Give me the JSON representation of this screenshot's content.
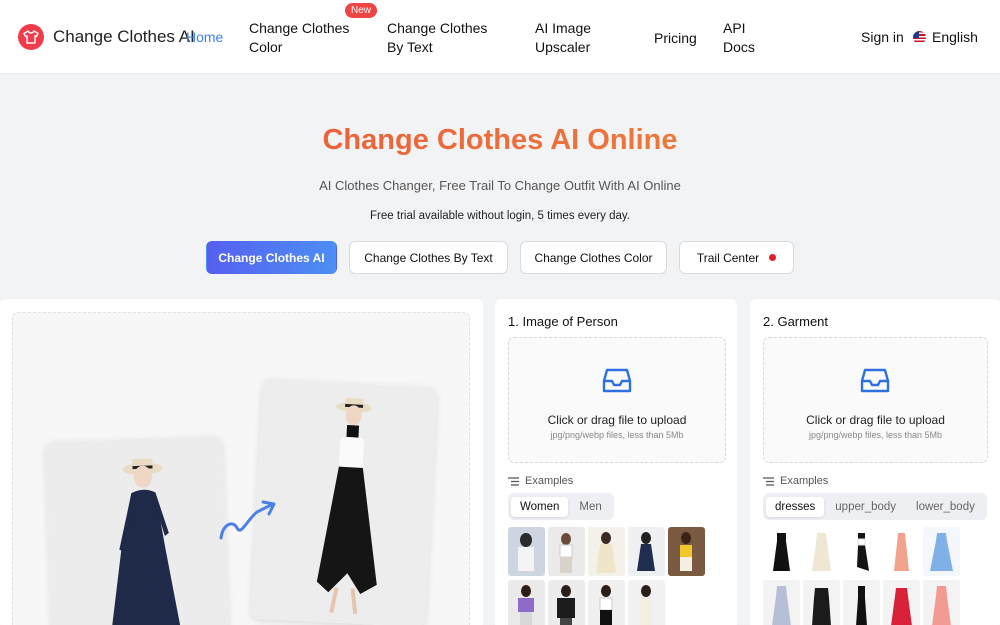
{
  "header": {
    "brand": "Change Clothes AI",
    "nav": [
      "Home",
      "Change Clothes Color",
      "Change Clothes By Text",
      "AI Image Upscaler",
      "Pricing",
      "API Docs"
    ],
    "badge_new": "New",
    "signin": "Sign in",
    "language": "English"
  },
  "hero": {
    "title": "Change Clothes AI Online",
    "subtitle": "AI Clothes Changer, Free Trail To Change Outfit With AI Online",
    "note": "Free trial available without login, 5 times every day.",
    "tabs": [
      "Change Clothes AI",
      "Change Clothes By Text",
      "Change Clothes Color",
      "Trail Center"
    ]
  },
  "person": {
    "title": "1. Image of Person",
    "upload_text": "Click or drag file to upload",
    "upload_hint": "jpg/png/webp files, less than 5Mb",
    "examples_label": "Examples",
    "categories": [
      "Women",
      "Men"
    ],
    "selected_category": "Women"
  },
  "garment": {
    "title": "2. Garment",
    "upload_text": "Click or drag file to upload",
    "upload_hint": "jpg/png/webp files, less than 5Mb",
    "examples_label": "Examples",
    "categories": [
      "dresses",
      "upper_body",
      "lower_body"
    ],
    "selected_category": "dresses"
  },
  "colors": {
    "accent": "#3b82f6",
    "brand_red": "#ef3b4a",
    "title_gradient": [
      "#e8503a",
      "#f08a3b"
    ],
    "active_tab": [
      "#5660f0",
      "#4d8ff4"
    ]
  }
}
